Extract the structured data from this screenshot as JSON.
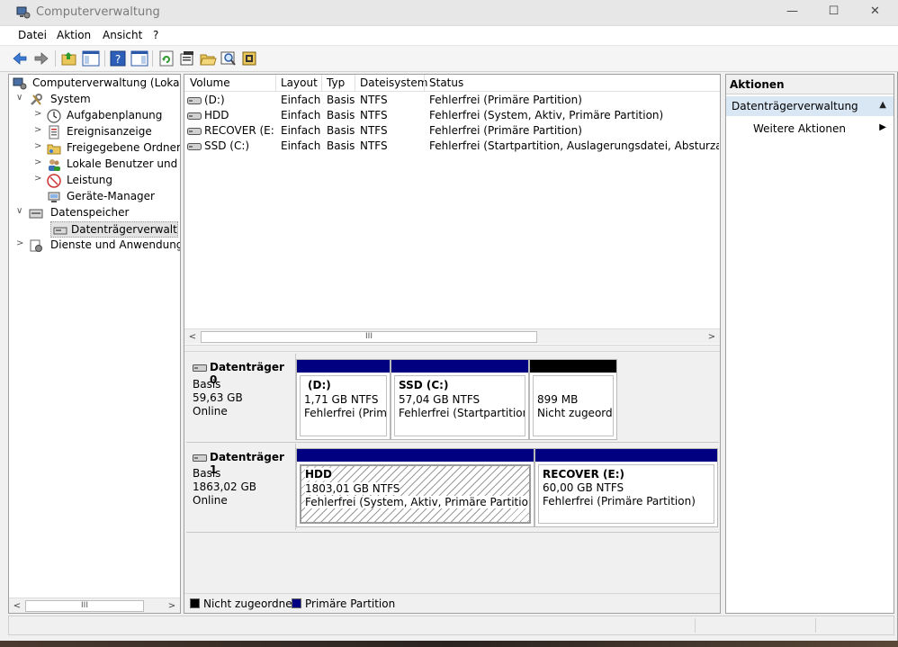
{
  "window": {
    "title": "Computerverwaltung",
    "min_glyph": "—",
    "max_glyph": "☐",
    "close_glyph": "✕"
  },
  "menu": {
    "items": [
      "Datei",
      "Aktion",
      "Ansicht",
      "?"
    ]
  },
  "toolbar": {
    "icons": [
      "back-arrow-icon",
      "forward-arrow-icon",
      "up-folder-icon",
      "show-hide-tree-icon",
      "help-icon",
      "panel-icon",
      "refresh-icon",
      "properties-icon",
      "open-folder-icon",
      "search-icon",
      "settings-icon"
    ]
  },
  "tree": {
    "root": "Computerverwaltung (Lokal)",
    "items": [
      {
        "label": "System",
        "expand": "∨"
      },
      {
        "label": "Aufgabenplanung",
        "expand": ">"
      },
      {
        "label": "Ereignisanzeige",
        "expand": ">"
      },
      {
        "label": "Freigegebene Ordner",
        "expand": ">"
      },
      {
        "label": "Lokale Benutzer und Gruppen",
        "expand": ">"
      },
      {
        "label": "Leistung",
        "expand": ">"
      },
      {
        "label": "Geräte-Manager",
        "expand": ""
      },
      {
        "label": "Datenspeicher",
        "expand": "∨"
      },
      {
        "label": "Datenträgerverwaltung",
        "expand": ""
      },
      {
        "label": "Dienste und Anwendungen",
        "expand": ">"
      }
    ],
    "root_expand": ""
  },
  "volumes": {
    "columns": [
      "Volume",
      "Layout",
      "Typ",
      "Dateisystem",
      "Status"
    ],
    "rows": [
      [
        "(D:)",
        "Einfach",
        "Basis",
        "NTFS",
        "Fehlerfrei (Primäre Partition)"
      ],
      [
        "HDD",
        "Einfach",
        "Basis",
        "NTFS",
        "Fehlerfrei (System, Aktiv, Primäre Partition)"
      ],
      [
        "RECOVER (E:)",
        "Einfach",
        "Basis",
        "NTFS",
        "Fehlerfrei (Primäre Partition)"
      ],
      [
        "SSD (C:)",
        "Einfach",
        "Basis",
        "NTFS",
        "Fehlerfrei (Startpartition, Auslagerungsdatei, Absturzabbild, P"
      ]
    ]
  },
  "scroll": {
    "left": "<",
    "right": ">",
    "grip": "III"
  },
  "disks": [
    {
      "name": "Datenträger 0",
      "type": "Basis",
      "size": "59,63 GB",
      "state": "Online",
      "partitions": [
        {
          "title": "(D:)",
          "line1": "1,71 GB NTFS",
          "line2": "Fehlerfrei (Primä"
        },
        {
          "title": "SSD  (C:)",
          "line1": "57,04 GB NTFS",
          "line2": "Fehlerfrei (Startpartition, A"
        },
        {
          "title": "",
          "line1": "899 MB",
          "line2": "Nicht zugeordn"
        }
      ]
    },
    {
      "name": "Datenträger 1",
      "type": "Basis",
      "size": "1863,02 GB",
      "state": "Online",
      "partitions": [
        {
          "title": "HDD",
          "line1": "1803,01 GB NTFS",
          "line2": "Fehlerfrei (System, Aktiv, Primäre Partition)"
        },
        {
          "title": "RECOVER  (E:)",
          "line1": "60,00 GB NTFS",
          "line2": "Fehlerfrei (Primäre Partition)"
        }
      ]
    }
  ],
  "legend": {
    "unallocated": "Nicht zugeordnet",
    "primary": "Primäre Partition",
    "unallocated_color": "#000000",
    "primary_color": "#000080"
  },
  "actions": {
    "header": "Aktionen",
    "section": "Datenträgerverwaltung",
    "section_glyph": "▲",
    "item": "Weitere Aktionen",
    "item_glyph": "▶"
  }
}
